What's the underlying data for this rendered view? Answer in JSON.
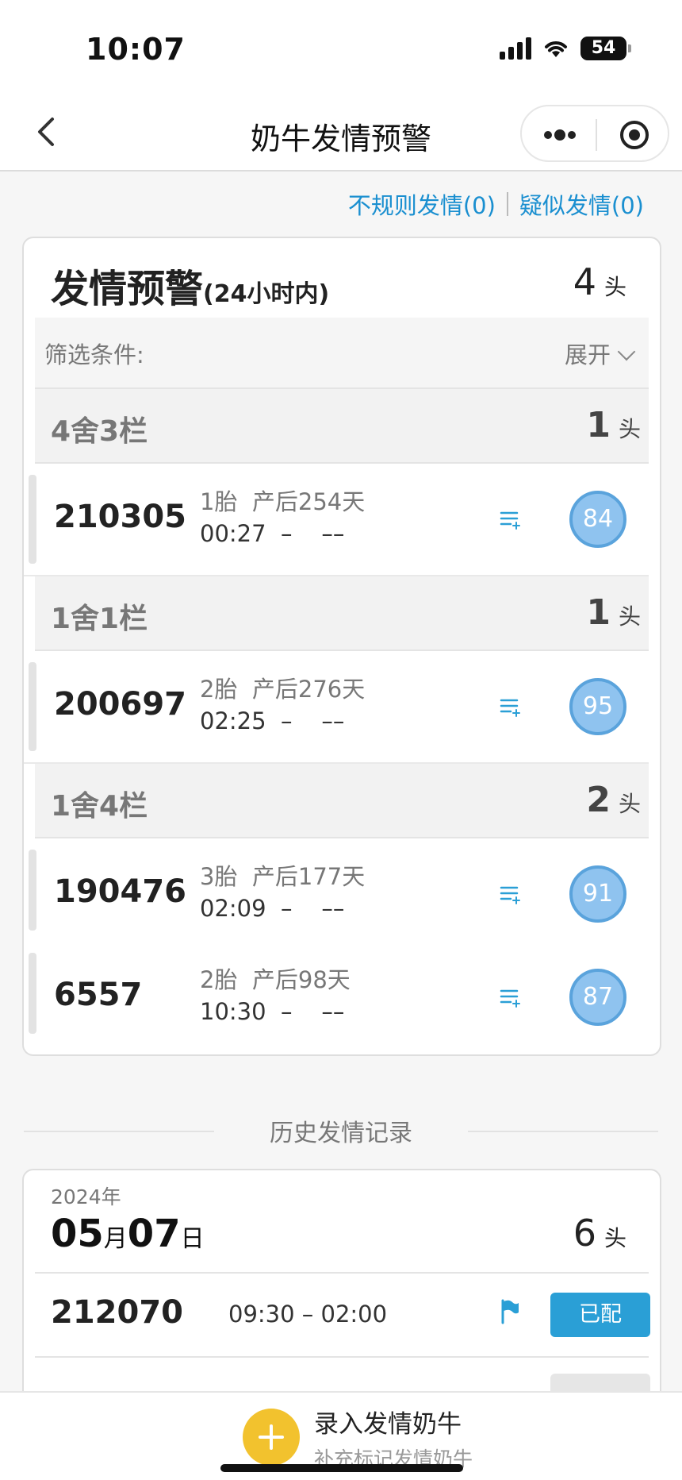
{
  "status_bar": {
    "time": "10:07",
    "battery": "54"
  },
  "nav": {
    "title": "奶牛发情预警"
  },
  "links": {
    "irregular": "不规则发情(0)",
    "suspected": "疑似发情(0)"
  },
  "alert": {
    "title": "发情预警",
    "title_suffix": "(24小时内)",
    "count": "4",
    "unit": "头",
    "filter_label": "筛选条件:",
    "filter_expand": "展开",
    "groups": [
      {
        "name": "4舍3栏",
        "count": "1",
        "unit": "头",
        "cows": [
          {
            "id": "210305",
            "parity": "1胎",
            "days": "产后254天",
            "time": "00:27",
            "dash": "–",
            "end": "––",
            "score": "84"
          }
        ]
      },
      {
        "name": "1舍1栏",
        "count": "1",
        "unit": "头",
        "cows": [
          {
            "id": "200697",
            "parity": "2胎",
            "days": "产后276天",
            "time": "02:25",
            "dash": "–",
            "end": "––",
            "score": "95"
          }
        ]
      },
      {
        "name": "1舍4栏",
        "count": "2",
        "unit": "头",
        "cows": [
          {
            "id": "190476",
            "parity": "3胎",
            "days": "产后177天",
            "time": "02:09",
            "dash": "–",
            "end": "––",
            "score": "91"
          },
          {
            "id": "6557",
            "parity": "2胎",
            "days": "产后98天",
            "time": "10:30",
            "dash": "–",
            "end": "––",
            "score": "87"
          }
        ]
      }
    ]
  },
  "history": {
    "title": "历史发情记录",
    "year": "2024年",
    "month": "05",
    "month_unit": "月",
    "day": "07",
    "day_unit": "日",
    "count": "6",
    "unit": "头",
    "records": [
      {
        "id": "212070",
        "time": "09:30  –  02:00",
        "status": "已配"
      }
    ]
  },
  "bottom": {
    "label": "录入发情奶牛",
    "sub": "补充标记发情奶牛"
  },
  "colors": {
    "accent": "#2a9fd6",
    "score_fill": "#8fc3ef",
    "add_button": "#f2c22e"
  },
  "icons": [
    "back-icon",
    "more-icon",
    "target-icon",
    "list-icon",
    "flag-icon",
    "plus-icon"
  ]
}
